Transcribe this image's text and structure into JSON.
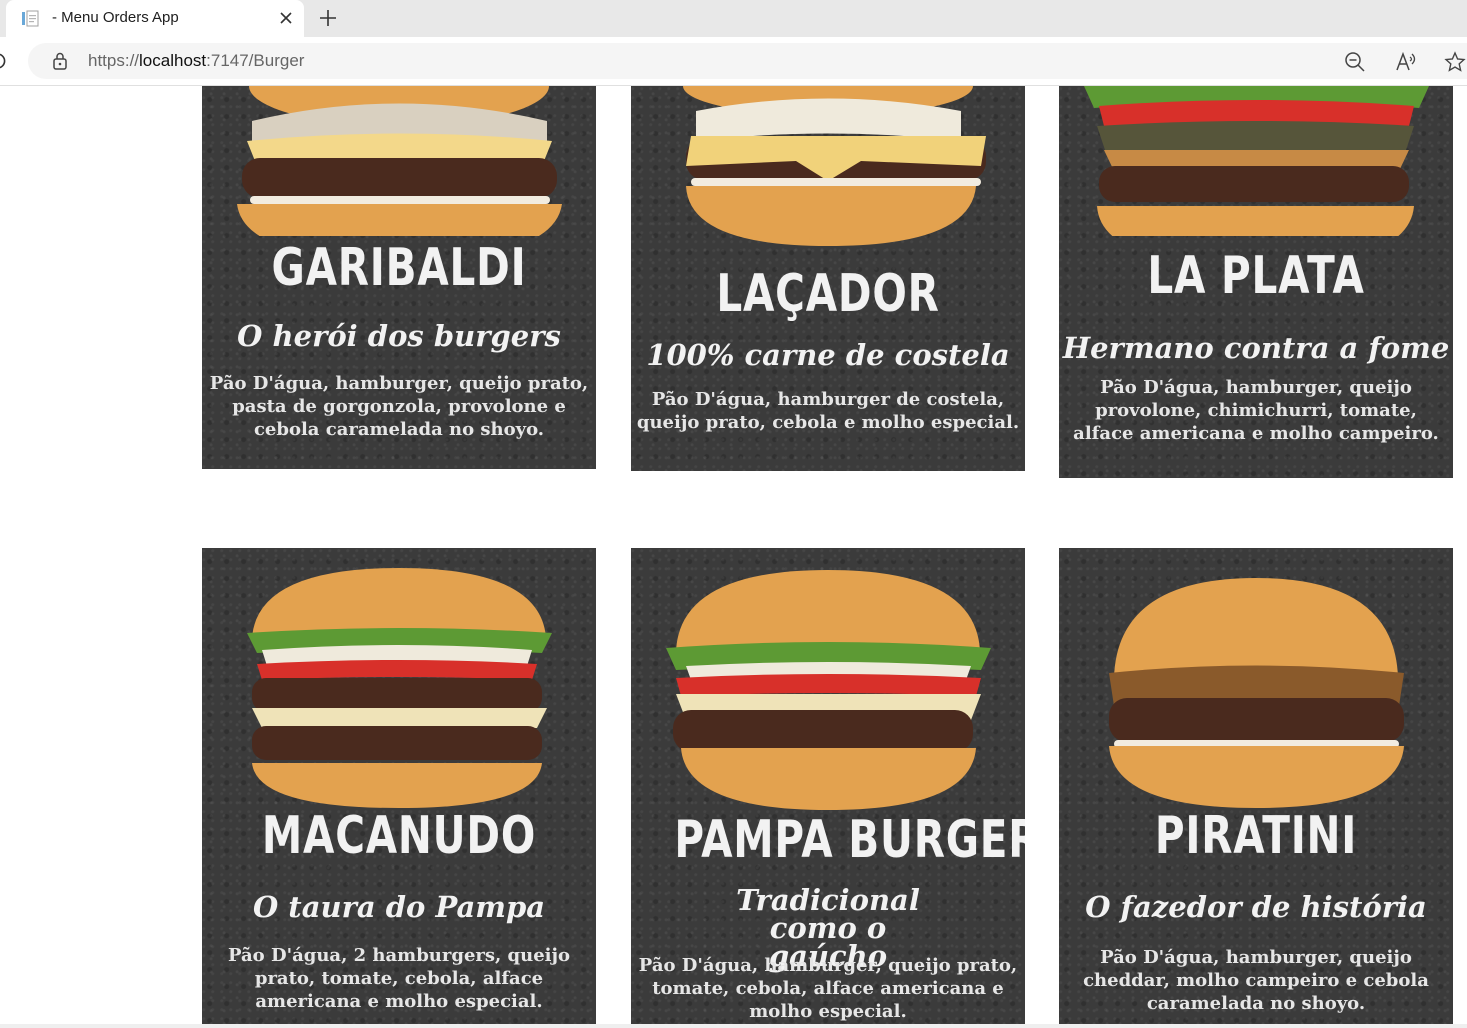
{
  "browser": {
    "tab_title": "- Menu Orders App",
    "url_scheme": "https://",
    "url_host": "localhost",
    "url_rest": ":7147/Burger"
  },
  "burgers": [
    {
      "name": "GARIBALDI",
      "slogan": "O herói dos burgers",
      "description": "Pão D'água, hamburger, queijo prato, pasta de gorgonzola, provolone e cebola caramelada no shoyo."
    },
    {
      "name": "LAÇADOR",
      "slogan": "100% carne de costela",
      "description": "Pão D'água, hamburger de costela, queijo prato, cebola e molho especial."
    },
    {
      "name": "LA PLATA",
      "slogan": "Hermano contra a fome",
      "description": "Pão D'água, hamburger, queijo provolone, chimichurri, tomate, alface americana e molho campeiro."
    },
    {
      "name": "MACANUDO",
      "slogan": "O taura do Pampa",
      "description": "Pão D'água, 2 hamburgers, queijo prato, tomate, cebola, alface americana e molho especial."
    },
    {
      "name": "PAMPA BURGER",
      "slogan": "Tradicional como o gaúcho",
      "description": "Pão D'água, hamburger, queijo prato, tomate, cebola, alface americana e molho especial."
    },
    {
      "name": "PIRATINI",
      "slogan": "O fazedor de história",
      "description": "Pão D'água, hamburger, queijo cheddar, molho campeiro e cebola caramelada no shoyo."
    }
  ],
  "colors": {
    "card_bg": "#3b3b3b",
    "bun": "#e3a24f",
    "patty": "#4a2a1e",
    "tomato": "#d8302a",
    "lettuce": "#5d9a34",
    "cheese": "#f1d27a"
  }
}
